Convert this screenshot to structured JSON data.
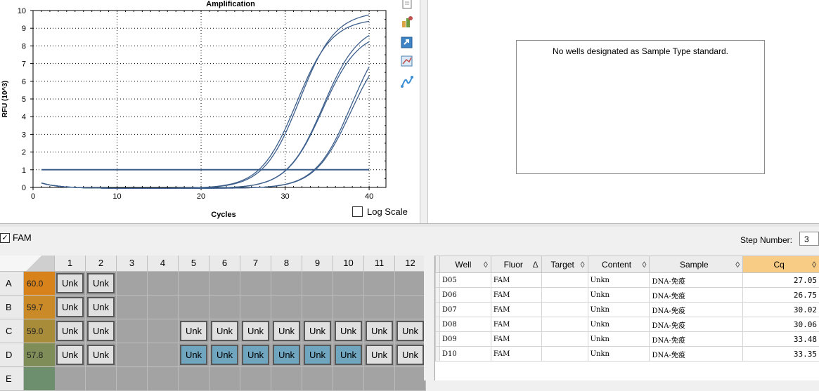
{
  "chart_data": {
    "type": "line",
    "title": "Amplification",
    "xlabel": "Cycles",
    "ylabel": "RFU (10^3)",
    "xlim": [
      0,
      42
    ],
    "ylim": [
      0,
      10
    ],
    "xticks": [
      0,
      10,
      20,
      30,
      40
    ],
    "yticks": [
      0,
      1,
      2,
      3,
      4,
      5,
      6,
      7,
      8,
      9,
      10
    ],
    "grid": true,
    "threshold": 1.0,
    "series": [
      {
        "well": "D05",
        "cq": 27.05,
        "plateau": 10.0
      },
      {
        "well": "D06",
        "cq": 26.75,
        "plateau": 9.6
      },
      {
        "well": "D07",
        "cq": 30.02,
        "plateau": 9.3
      },
      {
        "well": "D08",
        "cq": 30.06,
        "plateau": 8.9
      },
      {
        "well": "D09",
        "cq": 33.48,
        "plateau": 8.6
      },
      {
        "well": "D10",
        "cq": 33.35,
        "plateau": 9.4
      }
    ],
    "color": "#3d5f8c"
  },
  "toolbar_icons": [
    "clipboard-icon",
    "chart-settings-icon",
    "export-icon",
    "zoom-chart-icon",
    "curve-style-icon"
  ],
  "log_scale_label": "Log Scale",
  "standard_curve_message": "No wells designated as Sample Type standard.",
  "fluor_checkbox": {
    "label": "FAM",
    "checked": true
  },
  "step_number": {
    "label": "Step Number:",
    "value": "3"
  },
  "plate": {
    "columns": [
      "1",
      "2",
      "3",
      "4",
      "5",
      "6",
      "7",
      "8",
      "9",
      "10",
      "11",
      "12"
    ],
    "rows": [
      {
        "label": "A",
        "temp": "60.0",
        "temp_color": "#d8821c",
        "wells": [
          "Unk",
          "Unk",
          "",
          "",
          "",
          "",
          "",
          "",
          "",
          "",
          "",
          ""
        ],
        "selected": []
      },
      {
        "label": "B",
        "temp": "59.7",
        "temp_color": "#c98a27",
        "wells": [
          "Unk",
          "Unk",
          "",
          "",
          "",
          "",
          "",
          "",
          "",
          "",
          "",
          ""
        ],
        "selected": []
      },
      {
        "label": "C",
        "temp": "59.0",
        "temp_color": "#a88c3a",
        "wells": [
          "Unk",
          "Unk",
          "",
          "",
          "Unk",
          "Unk",
          "Unk",
          "Unk",
          "Unk",
          "Unk",
          "Unk",
          "Unk"
        ],
        "selected": []
      },
      {
        "label": "D",
        "temp": "57.8",
        "temp_color": "#7f8d58",
        "wells": [
          "Unk",
          "Unk",
          "",
          "",
          "Unk",
          "Unk",
          "Unk",
          "Unk",
          "Unk",
          "Unk",
          "Unk",
          "Unk"
        ],
        "selected": [
          4,
          5,
          6,
          7,
          8,
          9
        ]
      },
      {
        "label": "E",
        "temp": "",
        "temp_color": "#6d8f6d",
        "wells": [
          "",
          "",
          "",
          "",
          "",
          "",
          "",
          "",
          "",
          "",
          "",
          ""
        ],
        "selected": []
      }
    ]
  },
  "results": {
    "columns": [
      {
        "label": "Well",
        "sort": "◊"
      },
      {
        "label": "Fluor",
        "sort": "Δ"
      },
      {
        "label": "Target",
        "sort": "◊"
      },
      {
        "label": "Content",
        "sort": "◊"
      },
      {
        "label": "Sample",
        "sort": "◊"
      },
      {
        "label": "Cq",
        "sort": "◊"
      }
    ],
    "rows": [
      [
        "D05",
        "FAM",
        "",
        "Unkn",
        "DNA-免疫",
        "27.05"
      ],
      [
        "D06",
        "FAM",
        "",
        "Unkn",
        "DNA-免疫",
        "26.75"
      ],
      [
        "D07",
        "FAM",
        "",
        "Unkn",
        "DNA-免疫",
        "30.02"
      ],
      [
        "D08",
        "FAM",
        "",
        "Unkn",
        "DNA-免疫",
        "30.06"
      ],
      [
        "D09",
        "FAM",
        "",
        "Unkn",
        "DNA-免疫",
        "33.48"
      ],
      [
        "D10",
        "FAM",
        "",
        "Unkn",
        "DNA-免疫",
        "33.35"
      ]
    ]
  }
}
